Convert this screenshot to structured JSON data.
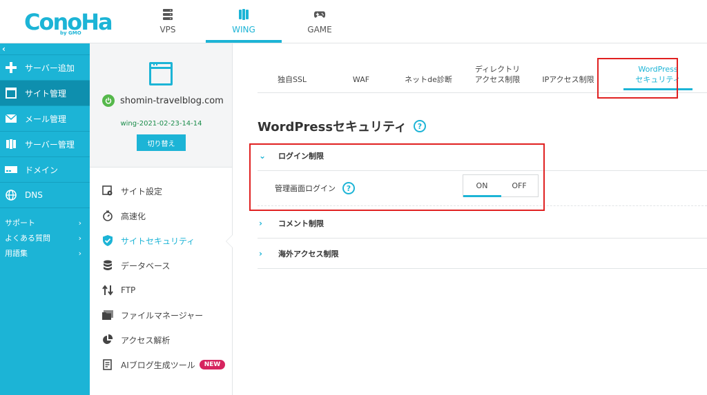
{
  "brand": {
    "logo_text": "ConoHa",
    "by": "by GMO",
    "accent": "#1cb4d6"
  },
  "topnav": [
    {
      "label": "VPS",
      "icon": "server-icon"
    },
    {
      "label": "WING",
      "icon": "wing-icon",
      "active": true
    },
    {
      "label": "GAME",
      "icon": "gamepad-icon"
    }
  ],
  "sidebar": {
    "collapse": "‹",
    "items": [
      {
        "label": "サーバー追加",
        "icon": "plus-icon"
      },
      {
        "label": "サイト管理",
        "icon": "window-icon",
        "active": true
      },
      {
        "label": "メール管理",
        "icon": "mail-icon"
      },
      {
        "label": "サーバー管理",
        "icon": "server-icon"
      },
      {
        "label": "ドメイン",
        "icon": "domain-icon"
      },
      {
        "label": "DNS",
        "icon": "globe-icon"
      }
    ],
    "links": [
      {
        "label": "サポート"
      },
      {
        "label": "よくある質問"
      },
      {
        "label": "用語集"
      }
    ]
  },
  "site": {
    "domain": "shomin-travelblog.com",
    "wing_id": "wing-2021-02-23-14-14",
    "switch_label": "切り替え"
  },
  "menu": [
    {
      "label": "サイト設定",
      "icon": "site-settings-icon"
    },
    {
      "label": "高速化",
      "icon": "stopwatch-icon"
    },
    {
      "label": "サイトセキュリティ",
      "icon": "shield-check-icon",
      "active": true
    },
    {
      "label": "データベース",
      "icon": "database-icon"
    },
    {
      "label": "FTP",
      "icon": "transfer-icon"
    },
    {
      "label": "ファイルマネージャー",
      "icon": "folder-icon"
    },
    {
      "label": "アクセス解析",
      "icon": "pie-chart-icon"
    },
    {
      "label": "AIブログ生成ツール",
      "icon": "document-icon",
      "badge": "NEW"
    }
  ],
  "tabs": [
    {
      "label": "独自SSL"
    },
    {
      "label": "WAF"
    },
    {
      "label": "ネットde診断"
    },
    {
      "label_line1": "ディレクトリ",
      "label_line2": "アクセス制限"
    },
    {
      "label": "IPアクセス制限"
    },
    {
      "label_line1": "WordPress",
      "label_line2": "セキュリティ",
      "active": true
    }
  ],
  "page": {
    "title": "WordPressセキュリティ",
    "help": "?",
    "sections": [
      {
        "label": "ログイン制限",
        "expanded": true
      },
      {
        "label": "コメント制限",
        "expanded": false
      },
      {
        "label": "海外アクセス制限",
        "expanded": false
      }
    ],
    "login_row": {
      "label": "管理画面ログイン",
      "on": "ON",
      "off": "OFF",
      "selected": "ON"
    }
  }
}
